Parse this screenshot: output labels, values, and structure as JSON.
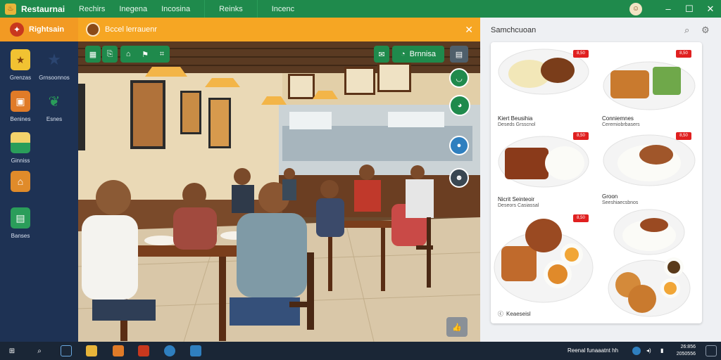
{
  "app": {
    "title": "Restaurnai"
  },
  "menu": [
    "Rechirs",
    "Inegena",
    "Incosina",
    "Reinks",
    "Incenc"
  ],
  "sidebar": {
    "title": "Rightsain",
    "items": [
      {
        "label": "Grenzas",
        "icon": "star-badge-icon",
        "color": "#f1c232"
      },
      {
        "label": "Grnsoonnos",
        "icon": "star-icon",
        "color": "#1e3254"
      },
      {
        "label": "Benines",
        "icon": "box-icon",
        "color": "#e07b28"
      },
      {
        "label": "Esnes",
        "icon": "leaf-icon",
        "color": "#1e3254"
      },
      {
        "label": "Ginniss",
        "icon": "landscape-icon",
        "color": "#2a9d5a"
      },
      {
        "label": "",
        "icon": "home-icon",
        "color": "#e08b2a"
      },
      {
        "label": "Banses",
        "icon": "document-icon",
        "color": "#2a9d5a"
      }
    ]
  },
  "photo_panel": {
    "title": "Bccel lerrauenr",
    "toolbar_label": "Brnnisa"
  },
  "right_panel": {
    "title": "Samchcuoan",
    "dishes": [
      {
        "name": "Kiert Beusihia",
        "sub": "Deseds Grsscnol",
        "price": "8,50"
      },
      {
        "name": "Conniemnes",
        "sub": "Ceremiobrbasers",
        "price": "8,50"
      },
      {
        "name": "Nicrit Seinteoir",
        "sub": "Deseors Casiassal",
        "price": "8,50"
      },
      {
        "name": "Groon",
        "sub": "Seeshiaecsbnos",
        "price": "8,50"
      },
      {
        "name": "",
        "sub": "",
        "price": "8,50"
      }
    ],
    "footer": "Keaeseisl"
  },
  "taskbar": {
    "tray_text": "Reenal funaaatnt hh",
    "clock_time": "26:856",
    "clock_date": "2050556"
  },
  "colors": {
    "brand_green": "#1f8a4c",
    "accent_orange": "#f6a623",
    "sidebar_navy": "#1e3254"
  }
}
